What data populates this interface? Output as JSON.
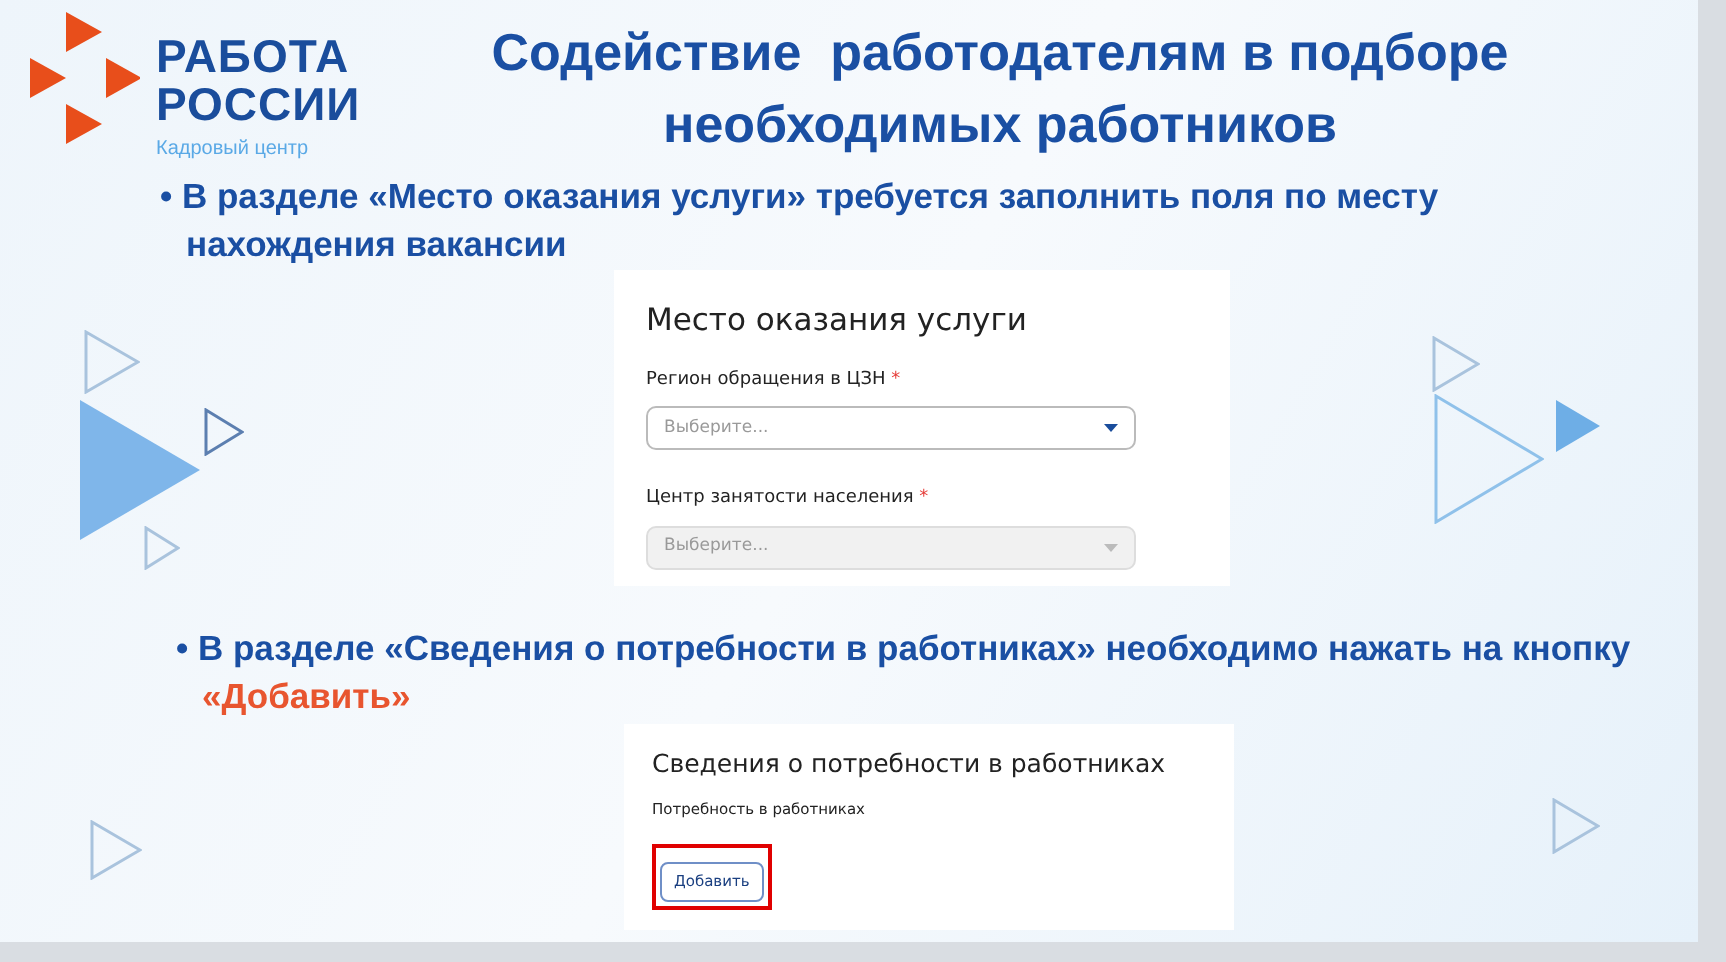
{
  "logo": {
    "title_lines": [
      "РАБОТА",
      "РОССИИ"
    ],
    "subtitle": "Кадровый центр"
  },
  "title_lines": [
    "Содействие  работодателям в подборе",
    "необходимых работников"
  ],
  "sections": [
    {
      "bullet": "•",
      "text": "В разделе «Место оказания услуги» требуется заполнить поля по месту нахождения вакансии",
      "panel": {
        "kind": "fields",
        "heading": "Место оказания услуги",
        "fields": [
          {
            "label": "Регион обращения в ЦЗН",
            "required_mark": "*",
            "placeholder": "Выберите...",
            "disabled": false
          },
          {
            "label": "Центр занятости населения",
            "required_mark": "*",
            "placeholder": "Выберите...",
            "disabled": true
          }
        ]
      }
    },
    {
      "bullet": "•",
      "text": "В разделе «Сведения о потребности в работниках» необходимо нажать на кнопку ",
      "highlight": "«Добавить»",
      "panel": {
        "kind": "button",
        "heading": "Сведения о потребности в работниках",
        "label": "Потребность в работниках",
        "button": {
          "label": "Добавить",
          "highlighted": true
        }
      }
    }
  ]
}
